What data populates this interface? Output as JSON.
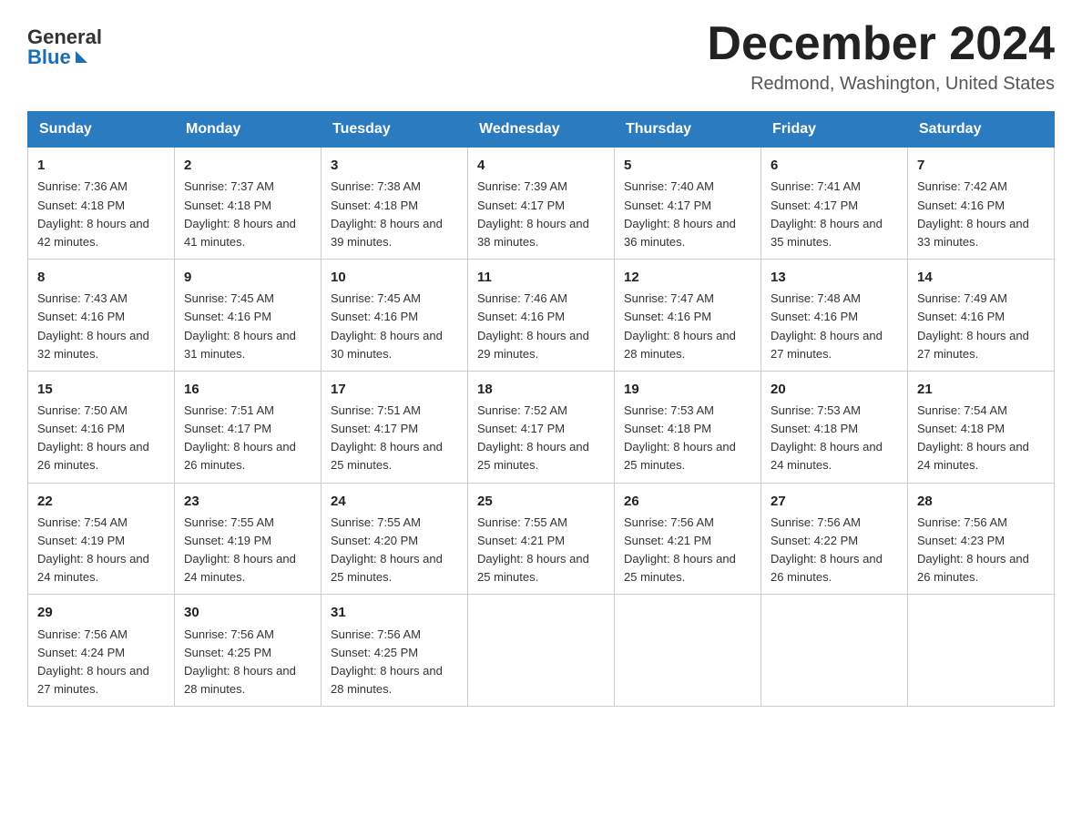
{
  "header": {
    "logo": {
      "general": "General",
      "blue": "Blue"
    },
    "title": "December 2024",
    "location": "Redmond, Washington, United States"
  },
  "days_of_week": [
    "Sunday",
    "Monday",
    "Tuesday",
    "Wednesday",
    "Thursday",
    "Friday",
    "Saturday"
  ],
  "weeks": [
    [
      {
        "day": "1",
        "sunrise": "7:36 AM",
        "sunset": "4:18 PM",
        "daylight": "8 hours and 42 minutes."
      },
      {
        "day": "2",
        "sunrise": "7:37 AM",
        "sunset": "4:18 PM",
        "daylight": "8 hours and 41 minutes."
      },
      {
        "day": "3",
        "sunrise": "7:38 AM",
        "sunset": "4:18 PM",
        "daylight": "8 hours and 39 minutes."
      },
      {
        "day": "4",
        "sunrise": "7:39 AM",
        "sunset": "4:17 PM",
        "daylight": "8 hours and 38 minutes."
      },
      {
        "day": "5",
        "sunrise": "7:40 AM",
        "sunset": "4:17 PM",
        "daylight": "8 hours and 36 minutes."
      },
      {
        "day": "6",
        "sunrise": "7:41 AM",
        "sunset": "4:17 PM",
        "daylight": "8 hours and 35 minutes."
      },
      {
        "day": "7",
        "sunrise": "7:42 AM",
        "sunset": "4:16 PM",
        "daylight": "8 hours and 33 minutes."
      }
    ],
    [
      {
        "day": "8",
        "sunrise": "7:43 AM",
        "sunset": "4:16 PM",
        "daylight": "8 hours and 32 minutes."
      },
      {
        "day": "9",
        "sunrise": "7:45 AM",
        "sunset": "4:16 PM",
        "daylight": "8 hours and 31 minutes."
      },
      {
        "day": "10",
        "sunrise": "7:45 AM",
        "sunset": "4:16 PM",
        "daylight": "8 hours and 30 minutes."
      },
      {
        "day": "11",
        "sunrise": "7:46 AM",
        "sunset": "4:16 PM",
        "daylight": "8 hours and 29 minutes."
      },
      {
        "day": "12",
        "sunrise": "7:47 AM",
        "sunset": "4:16 PM",
        "daylight": "8 hours and 28 minutes."
      },
      {
        "day": "13",
        "sunrise": "7:48 AM",
        "sunset": "4:16 PM",
        "daylight": "8 hours and 27 minutes."
      },
      {
        "day": "14",
        "sunrise": "7:49 AM",
        "sunset": "4:16 PM",
        "daylight": "8 hours and 27 minutes."
      }
    ],
    [
      {
        "day": "15",
        "sunrise": "7:50 AM",
        "sunset": "4:16 PM",
        "daylight": "8 hours and 26 minutes."
      },
      {
        "day": "16",
        "sunrise": "7:51 AM",
        "sunset": "4:17 PM",
        "daylight": "8 hours and 26 minutes."
      },
      {
        "day": "17",
        "sunrise": "7:51 AM",
        "sunset": "4:17 PM",
        "daylight": "8 hours and 25 minutes."
      },
      {
        "day": "18",
        "sunrise": "7:52 AM",
        "sunset": "4:17 PM",
        "daylight": "8 hours and 25 minutes."
      },
      {
        "day": "19",
        "sunrise": "7:53 AM",
        "sunset": "4:18 PM",
        "daylight": "8 hours and 25 minutes."
      },
      {
        "day": "20",
        "sunrise": "7:53 AM",
        "sunset": "4:18 PM",
        "daylight": "8 hours and 24 minutes."
      },
      {
        "day": "21",
        "sunrise": "7:54 AM",
        "sunset": "4:18 PM",
        "daylight": "8 hours and 24 minutes."
      }
    ],
    [
      {
        "day": "22",
        "sunrise": "7:54 AM",
        "sunset": "4:19 PM",
        "daylight": "8 hours and 24 minutes."
      },
      {
        "day": "23",
        "sunrise": "7:55 AM",
        "sunset": "4:19 PM",
        "daylight": "8 hours and 24 minutes."
      },
      {
        "day": "24",
        "sunrise": "7:55 AM",
        "sunset": "4:20 PM",
        "daylight": "8 hours and 25 minutes."
      },
      {
        "day": "25",
        "sunrise": "7:55 AM",
        "sunset": "4:21 PM",
        "daylight": "8 hours and 25 minutes."
      },
      {
        "day": "26",
        "sunrise": "7:56 AM",
        "sunset": "4:21 PM",
        "daylight": "8 hours and 25 minutes."
      },
      {
        "day": "27",
        "sunrise": "7:56 AM",
        "sunset": "4:22 PM",
        "daylight": "8 hours and 26 minutes."
      },
      {
        "day": "28",
        "sunrise": "7:56 AM",
        "sunset": "4:23 PM",
        "daylight": "8 hours and 26 minutes."
      }
    ],
    [
      {
        "day": "29",
        "sunrise": "7:56 AM",
        "sunset": "4:24 PM",
        "daylight": "8 hours and 27 minutes."
      },
      {
        "day": "30",
        "sunrise": "7:56 AM",
        "sunset": "4:25 PM",
        "daylight": "8 hours and 28 minutes."
      },
      {
        "day": "31",
        "sunrise": "7:56 AM",
        "sunset": "4:25 PM",
        "daylight": "8 hours and 28 minutes."
      },
      null,
      null,
      null,
      null
    ]
  ]
}
